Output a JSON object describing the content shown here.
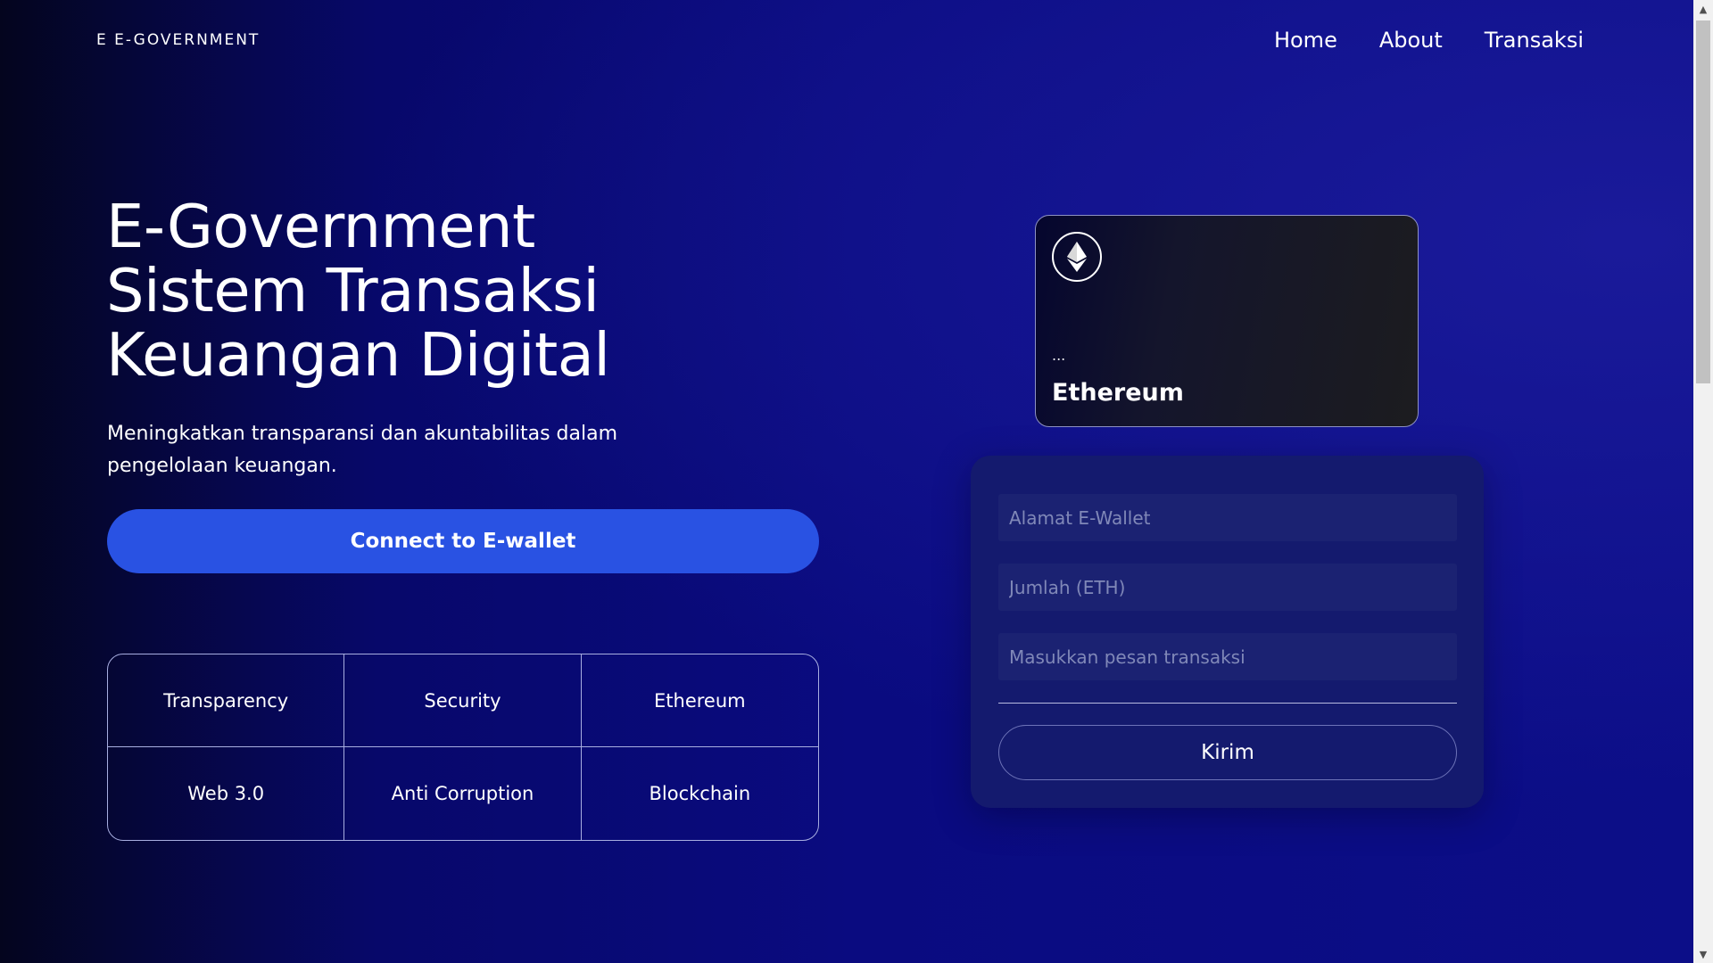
{
  "header": {
    "logo_text": "E E-GOVERNMENT",
    "nav": [
      {
        "label": "Home"
      },
      {
        "label": "About"
      },
      {
        "label": "Transaksi"
      }
    ]
  },
  "hero": {
    "title_lines": [
      "E-Government",
      "Sistem Transaksi",
      "Keuangan Digital"
    ],
    "subtitle": "Meningkatkan transparansi dan akuntabilitas dalam pengelolaan keuangan.",
    "connect_label": "Connect to E-wallet",
    "features": [
      "Transparency",
      "Security",
      "Ethereum",
      "Web 3.0",
      "Anti Corruption",
      "Blockchain"
    ]
  },
  "card": {
    "icon": "ethereum-icon",
    "address": "...",
    "network": "Ethereum"
  },
  "form": {
    "address_placeholder": "Alamat E-Wallet",
    "amount_placeholder": "Jumlah (ETH)",
    "message_placeholder": "Masukkan pesan transaksi",
    "submit_label": "Kirim"
  },
  "colors": {
    "accent": "#2952e3",
    "background": "#0a0b80",
    "panel": "#141a6e"
  }
}
